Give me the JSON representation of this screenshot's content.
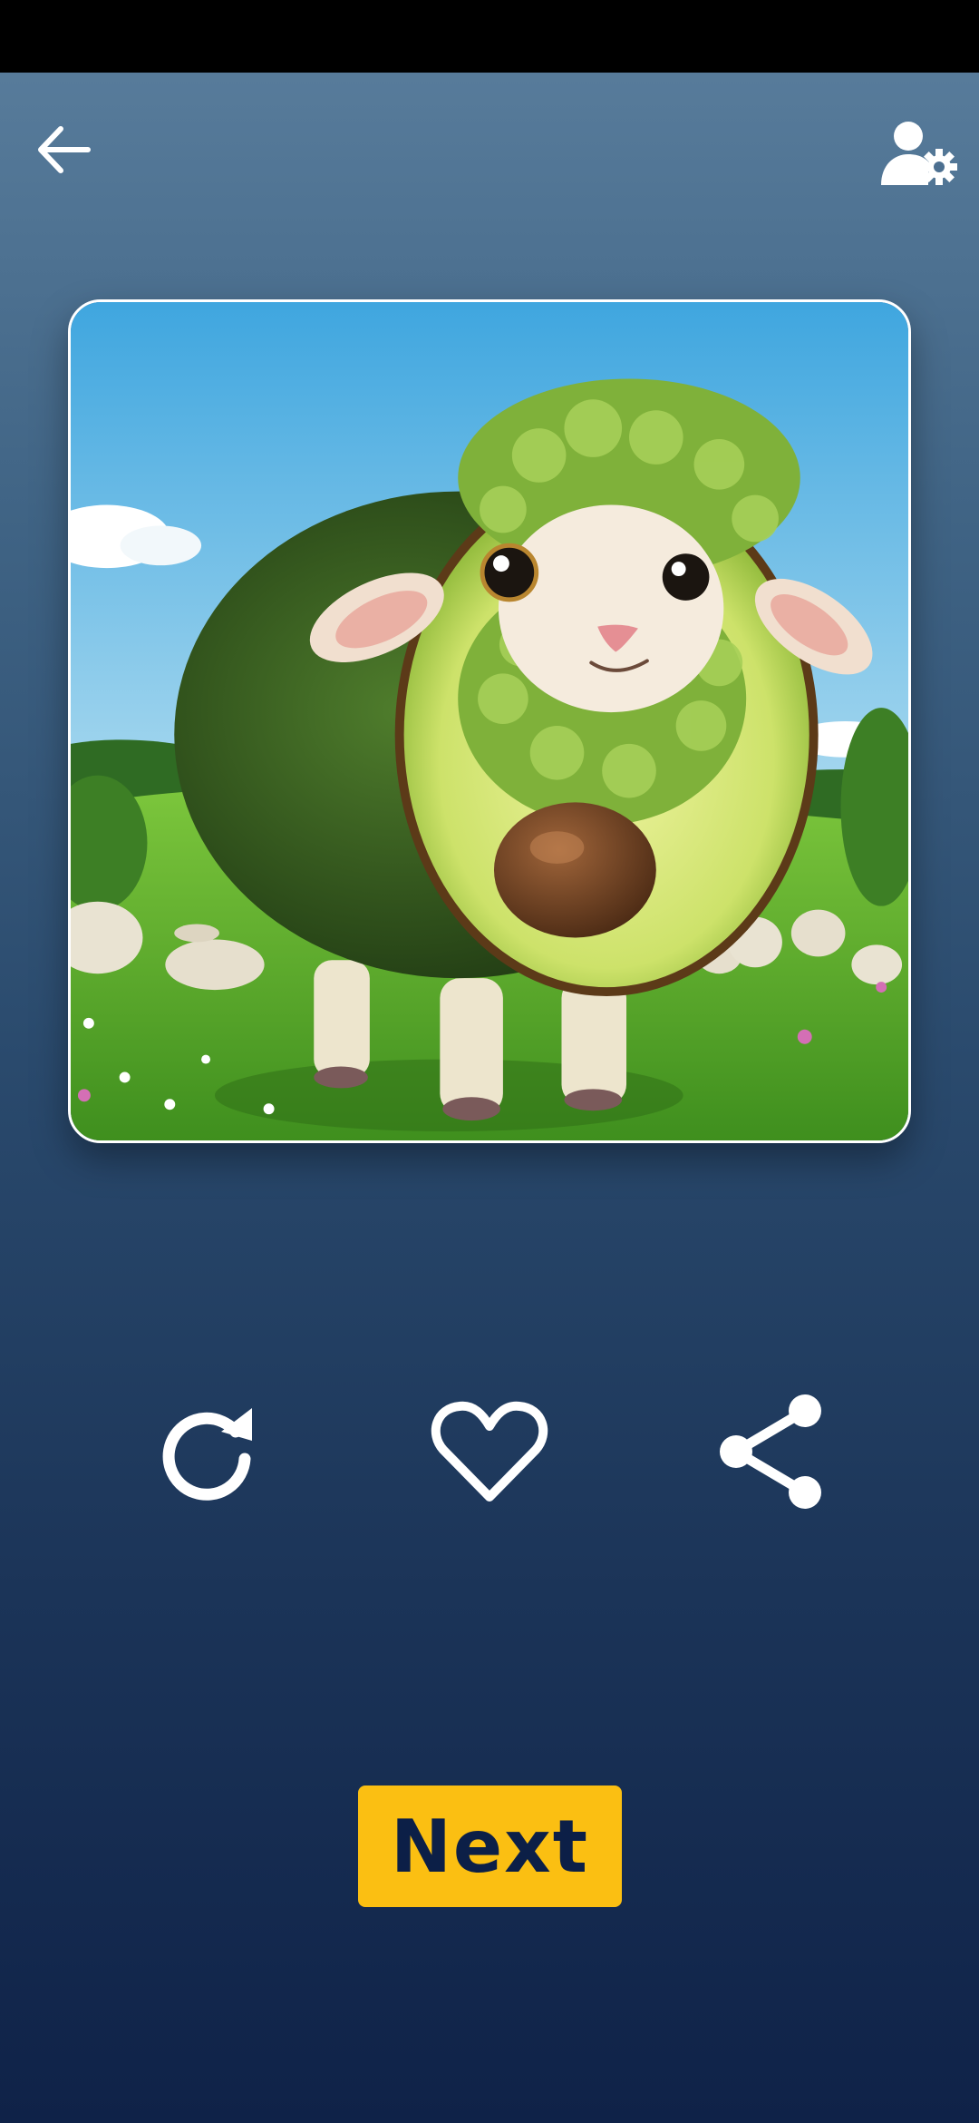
{
  "toolbar": {
    "back_icon": "arrow-left-icon",
    "profile_icon": "user-settings-icon"
  },
  "preview": {
    "image_subject": "avocado-sheep-image"
  },
  "actions": {
    "regenerate_icon": "refresh-icon",
    "like_icon": "heart-outline-icon",
    "share_icon": "share-icon"
  },
  "next_button": {
    "label": "Next"
  },
  "colors": {
    "accent": "#fbbf12",
    "button_text": "#0c1f47",
    "icon": "#ffffff"
  }
}
